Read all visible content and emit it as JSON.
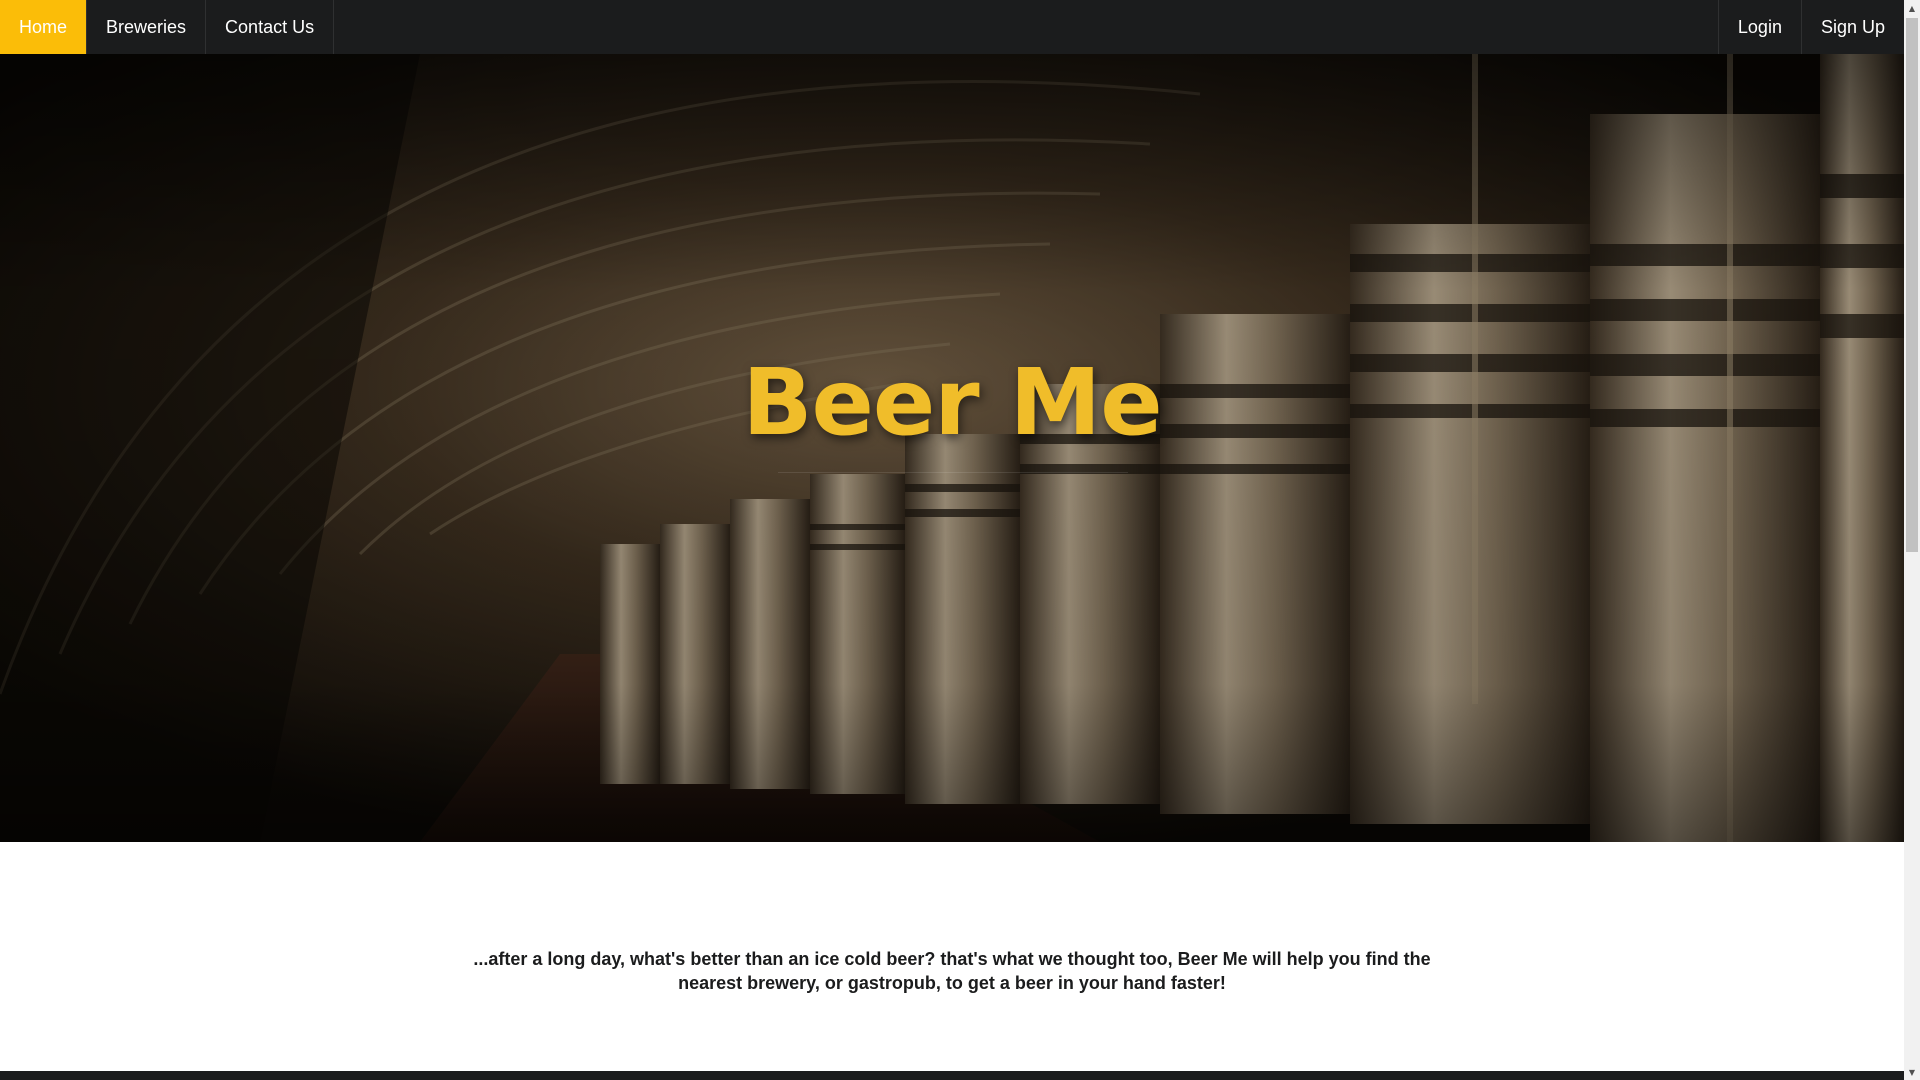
{
  "nav": {
    "left_items": [
      {
        "label": "Home",
        "active": true
      },
      {
        "label": "Breweries",
        "active": false
      },
      {
        "label": "Contact Us",
        "active": false
      }
    ],
    "right_items": [
      {
        "label": "Login"
      },
      {
        "label": "Sign Up"
      }
    ]
  },
  "hero": {
    "title": "Beer Me"
  },
  "tagline": "...after a long day, what's better than an ice cold beer? that's what we thought too, Beer Me will help you find the nearest brewery, or gastropub, to get a beer in your hand faster!",
  "colors": {
    "accent": "#fbbd08",
    "navbar_bg": "#1b1c1d",
    "title": "#f0bd2a"
  },
  "icons": {
    "scroll_up": "scroll-up-arrow",
    "scroll_down": "scroll-down-arrow"
  }
}
